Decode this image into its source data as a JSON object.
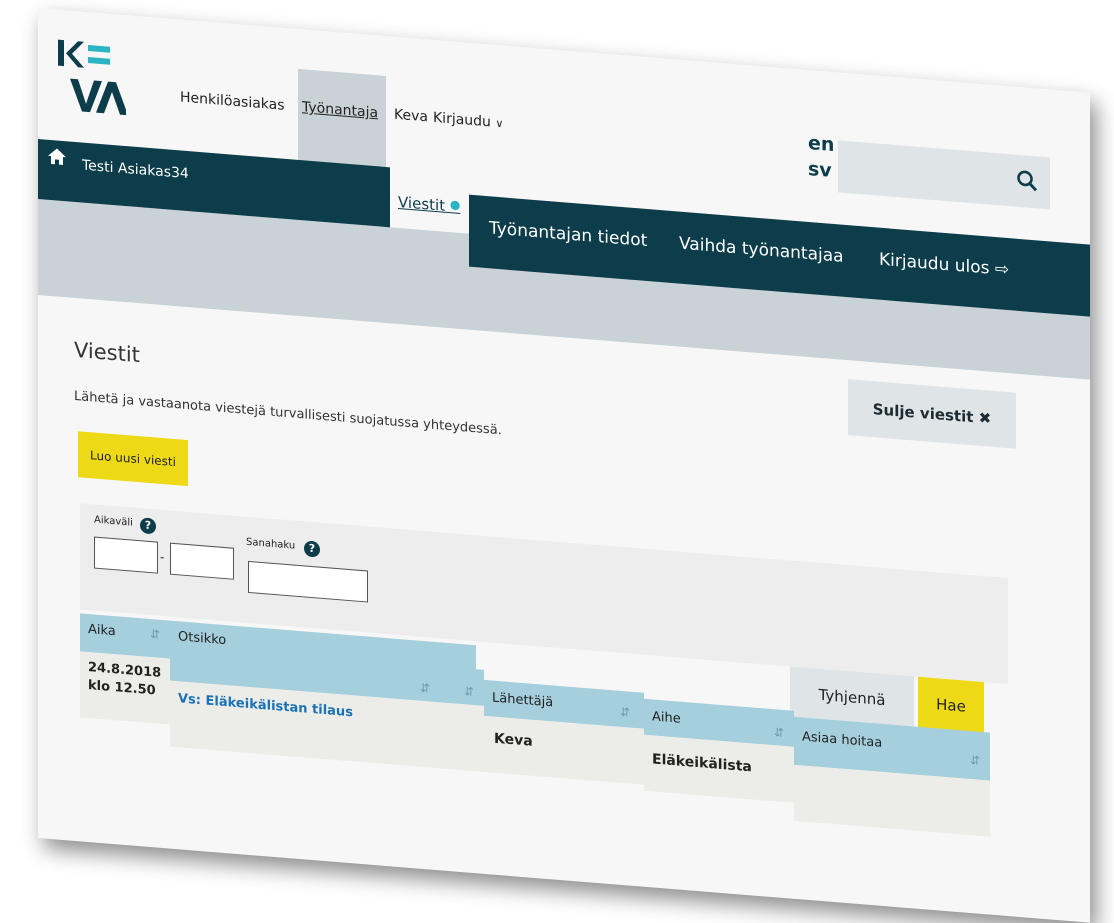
{
  "logo": {
    "text": "KEVA",
    "accent": "#2bb4c3",
    "dark": "#0d3d4a"
  },
  "topnav": {
    "items": [
      {
        "label": "Henkilöasiakas"
      },
      {
        "label": "Työnantaja"
      },
      {
        "label": "Keva"
      },
      {
        "label": "Kirjaudu"
      }
    ],
    "lang_en": "en",
    "lang_sv": "sv",
    "search_icon": "search-icon"
  },
  "subnav": {
    "user": "Testi Asiakas34",
    "home_icon": "home-icon",
    "items": [
      {
        "label": "Viestit"
      },
      {
        "label": "Työnantajan tiedot"
      },
      {
        "label": "Vaihda työnantajaa"
      },
      {
        "label": "Kirjaudu ulos"
      }
    ]
  },
  "messages": {
    "title": "Viestit",
    "intro": "Lähetä ja vastaanota viestejä turvallisesti suojatussa yhteydessä.",
    "new_button": "Luo uusi viesti",
    "close_button": "Sulje viestit",
    "close_icon": "✖"
  },
  "filter": {
    "range_label": "Aikaväli",
    "search_label": "Sanahaku",
    "separator": "-",
    "help": "?",
    "clear_button": "Tyhjennä",
    "search_button": "Hae"
  },
  "table": {
    "headers": [
      "Aika",
      "Otsikko",
      "Lähettäjä",
      "Aihe",
      "Asiaa hoitaa"
    ],
    "rows": [
      {
        "date": "24.8.2018",
        "time": "klo 12.50",
        "title": "Vs: Eläkeikälistan tilaus",
        "sender": "Keva",
        "topic": "Eläkeikälista",
        "handler": ""
      }
    ]
  },
  "colors": {
    "dark_teal": "#0d3d4a",
    "yellow": "#eed917",
    "header_blue": "#a5cfdc",
    "light_grey": "#c9d2d6"
  }
}
